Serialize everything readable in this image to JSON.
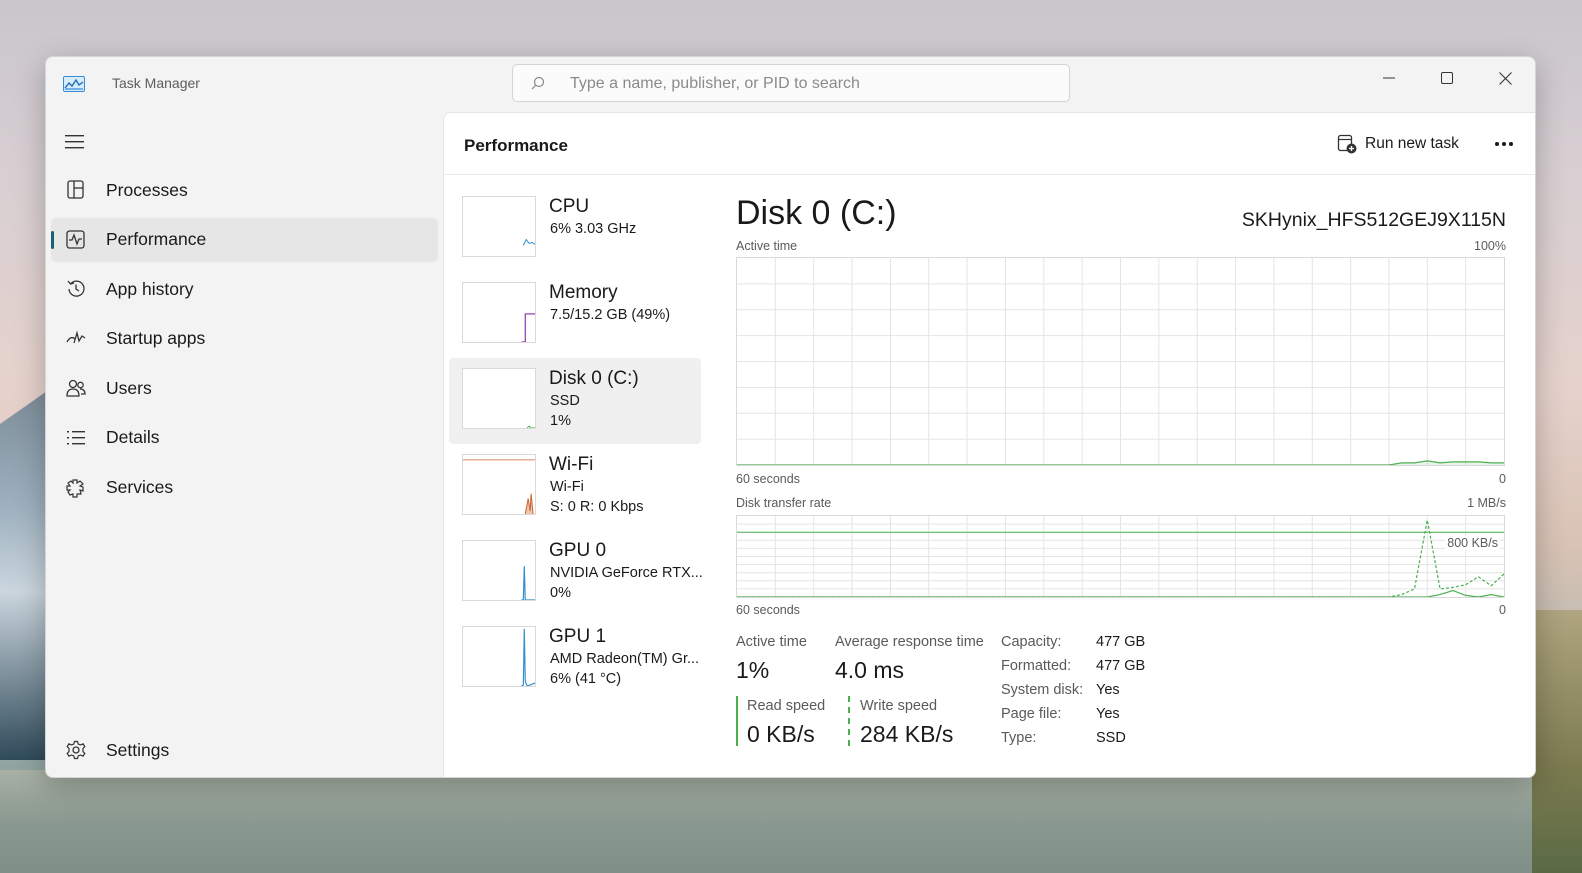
{
  "window": {
    "app_title": "Task Manager",
    "search_placeholder": "Type a name, publisher, or PID to search"
  },
  "nav": {
    "items": [
      {
        "label": "Processes",
        "icon": "processes-icon"
      },
      {
        "label": "Performance",
        "icon": "performance-icon",
        "active": true
      },
      {
        "label": "App history",
        "icon": "history-icon"
      },
      {
        "label": "Startup apps",
        "icon": "startup-icon"
      },
      {
        "label": "Users",
        "icon": "users-icon"
      },
      {
        "label": "Details",
        "icon": "details-icon"
      },
      {
        "label": "Services",
        "icon": "services-icon"
      }
    ],
    "settings_label": "Settings"
  },
  "header": {
    "title": "Performance",
    "run_new_task": "Run new task"
  },
  "perf_list": [
    {
      "name": "CPU",
      "sub1": "6%  3.03 GHz",
      "sub2": "",
      "color": "#2f8ecb"
    },
    {
      "name": "Memory",
      "sub1": "7.5/15.2 GB (49%)",
      "sub2": "",
      "color": "#8e2fa8"
    },
    {
      "name": "Disk 0 (C:)",
      "sub1": "SSD",
      "sub2": "1%",
      "color": "#4caf50",
      "active": true
    },
    {
      "name": "Wi-Fi",
      "sub1": "Wi-Fi",
      "sub2": "S: 0  R: 0 Kbps",
      "color": "#c8602b"
    },
    {
      "name": "GPU 0",
      "sub1": "NVIDIA GeForce RTX...",
      "sub2": "0%",
      "color": "#2f8ecb"
    },
    {
      "name": "GPU 1",
      "sub1": "AMD Radeon(TM) Gr...",
      "sub2": "6%  (41 °C)",
      "color": "#2f8ecb"
    }
  ],
  "detail": {
    "title": "Disk 0 (C:)",
    "model": "SKHynix_HFS512GEJ9X115N",
    "active_time_chart": {
      "label": "Active time",
      "max_label": "100%",
      "time_label": "60 seconds",
      "min_label": "0"
    },
    "transfer_chart": {
      "label": "Disk transfer rate",
      "max_label": "1 MB/s",
      "ref_label": "800 KB/s",
      "time_label": "60 seconds",
      "min_label": "0"
    },
    "stats": {
      "active_time_label": "Active time",
      "active_time_value": "1%",
      "avg_response_label": "Average response time",
      "avg_response_value": "4.0 ms",
      "read_speed_label": "Read speed",
      "read_speed_value": "0 KB/s",
      "write_speed_label": "Write speed",
      "write_speed_value": "284 KB/s"
    },
    "properties": [
      {
        "label": "Capacity:",
        "value": "477 GB"
      },
      {
        "label": "Formatted:",
        "value": "477 GB"
      },
      {
        "label": "System disk:",
        "value": "Yes"
      },
      {
        "label": "Page file:",
        "value": "Yes"
      },
      {
        "label": "Type:",
        "value": "SSD"
      }
    ]
  },
  "chart_data": [
    {
      "type": "area",
      "title": "Active time",
      "xlabel": "60 seconds",
      "ylabel": "%",
      "ylim": [
        0,
        100
      ],
      "x": [
        0,
        1,
        2,
        3,
        4,
        5,
        6,
        7,
        8,
        9,
        10,
        11,
        12,
        13,
        14,
        15,
        16,
        17,
        18,
        19,
        20,
        21,
        22,
        23,
        24,
        25,
        26,
        27,
        28,
        29,
        30,
        31,
        32,
        33,
        34,
        35,
        36,
        37,
        38,
        39,
        40,
        41,
        42,
        43,
        44,
        45,
        46,
        47,
        48,
        49,
        50,
        51,
        52,
        53,
        54,
        55,
        56,
        57,
        58,
        59,
        60
      ],
      "series": [
        {
          "name": "Active time",
          "values": [
            0,
            0,
            0,
            0,
            0,
            0,
            0,
            0,
            0,
            0,
            0,
            0,
            0,
            0,
            0,
            0,
            0,
            0,
            0,
            0,
            0,
            0,
            0,
            0,
            0,
            0,
            0,
            0,
            0,
            0,
            0,
            0,
            0,
            0,
            0,
            0,
            0,
            0,
            0,
            0,
            0,
            0,
            0,
            0,
            0,
            0,
            0,
            0,
            0,
            0,
            0,
            0,
            1,
            1,
            2,
            1,
            1.5,
            1.5,
            1.5,
            1,
            1
          ]
        }
      ],
      "grid": true
    },
    {
      "type": "line",
      "title": "Disk transfer rate",
      "xlabel": "60 seconds",
      "ylabel": "KB/s",
      "ylim": [
        0,
        1000
      ],
      "reference_line": 800,
      "x": [
        0,
        1,
        2,
        3,
        4,
        5,
        6,
        7,
        8,
        9,
        10,
        11,
        12,
        13,
        14,
        15,
        16,
        17,
        18,
        19,
        20,
        21,
        22,
        23,
        24,
        25,
        26,
        27,
        28,
        29,
        30,
        31,
        32,
        33,
        34,
        35,
        36,
        37,
        38,
        39,
        40,
        41,
        42,
        43,
        44,
        45,
        46,
        47,
        48,
        49,
        50,
        51,
        52,
        53,
        54,
        55,
        56,
        57,
        58,
        59,
        60
      ],
      "series": [
        {
          "name": "Write speed",
          "style": "dashed",
          "values": [
            0,
            0,
            0,
            0,
            0,
            0,
            0,
            0,
            0,
            0,
            0,
            0,
            0,
            0,
            0,
            0,
            0,
            0,
            0,
            0,
            0,
            0,
            0,
            0,
            0,
            0,
            0,
            0,
            0,
            0,
            0,
            0,
            0,
            0,
            0,
            0,
            0,
            0,
            0,
            0,
            0,
            0,
            0,
            0,
            0,
            0,
            0,
            0,
            0,
            0,
            0,
            0,
            30,
            100,
            950,
            100,
            120,
            150,
            250,
            140,
            284
          ]
        },
        {
          "name": "Read speed",
          "style": "solid",
          "values": [
            0,
            0,
            0,
            0,
            0,
            0,
            0,
            0,
            0,
            0,
            0,
            0,
            0,
            0,
            0,
            0,
            0,
            0,
            0,
            0,
            0,
            0,
            0,
            0,
            0,
            0,
            0,
            0,
            0,
            0,
            0,
            0,
            0,
            0,
            0,
            0,
            0,
            0,
            0,
            0,
            0,
            0,
            0,
            0,
            0,
            0,
            0,
            0,
            0,
            0,
            0,
            0,
            0,
            0,
            0,
            30,
            80,
            20,
            0,
            30,
            0
          ]
        }
      ],
      "grid": true
    }
  ]
}
